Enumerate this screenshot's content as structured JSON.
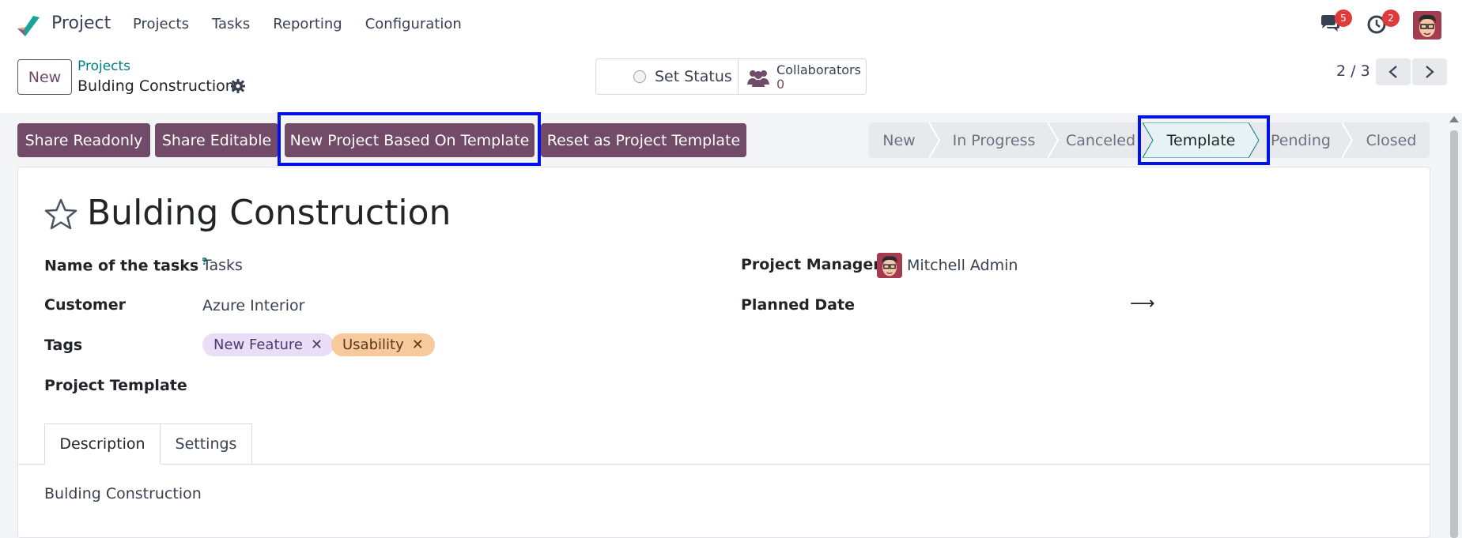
{
  "navbar": {
    "app_name": "Project",
    "menu": [
      "Projects",
      "Tasks",
      "Reporting",
      "Configuration"
    ],
    "messages_badge": "5",
    "activities_badge": "2"
  },
  "control_panel": {
    "new_label": "New",
    "breadcrumb_parent": "Projects",
    "breadcrumb_current": "Bulding Construction",
    "set_status_label": "Set Status",
    "collaborators_label": "Collaborators",
    "collaborators_count": "0",
    "pager": "2 / 3"
  },
  "actions": {
    "share_readonly": "Share Readonly",
    "share_editable": "Share Editable",
    "new_from_template": "New Project Based On Template",
    "reset_template": "Reset as Project Template"
  },
  "stages": [
    "New",
    "In Progress",
    "Canceled",
    "Template",
    "Pending",
    "Closed"
  ],
  "active_stage": "Template",
  "form": {
    "title": "Bulding Construction",
    "name_of_tasks_label": "Name of the tasks",
    "name_of_tasks_help": "?",
    "name_of_tasks_value": "Tasks",
    "customer_label": "Customer",
    "customer_value": "Azure Interior",
    "tags_label": "Tags",
    "tags": [
      {
        "label": "New Feature",
        "color": "#e9ddf7",
        "text_color": "#4b3a6b"
      },
      {
        "label": "Usability",
        "color": "#f7c99c",
        "text_color": "#5a3a17"
      }
    ],
    "project_template_label": "Project Template",
    "project_manager_label": "Project Manager",
    "project_manager_value": "Mitchell Admin",
    "planned_date_label": "Planned Date",
    "planned_date_arrow": "⟶"
  },
  "tabs": [
    "Description",
    "Settings"
  ],
  "description_text": "Bulding Construction",
  "colors": {
    "primary": "#714B67",
    "link": "#017e84",
    "highlight": "#0011ee",
    "badge": "#e03b3b"
  }
}
